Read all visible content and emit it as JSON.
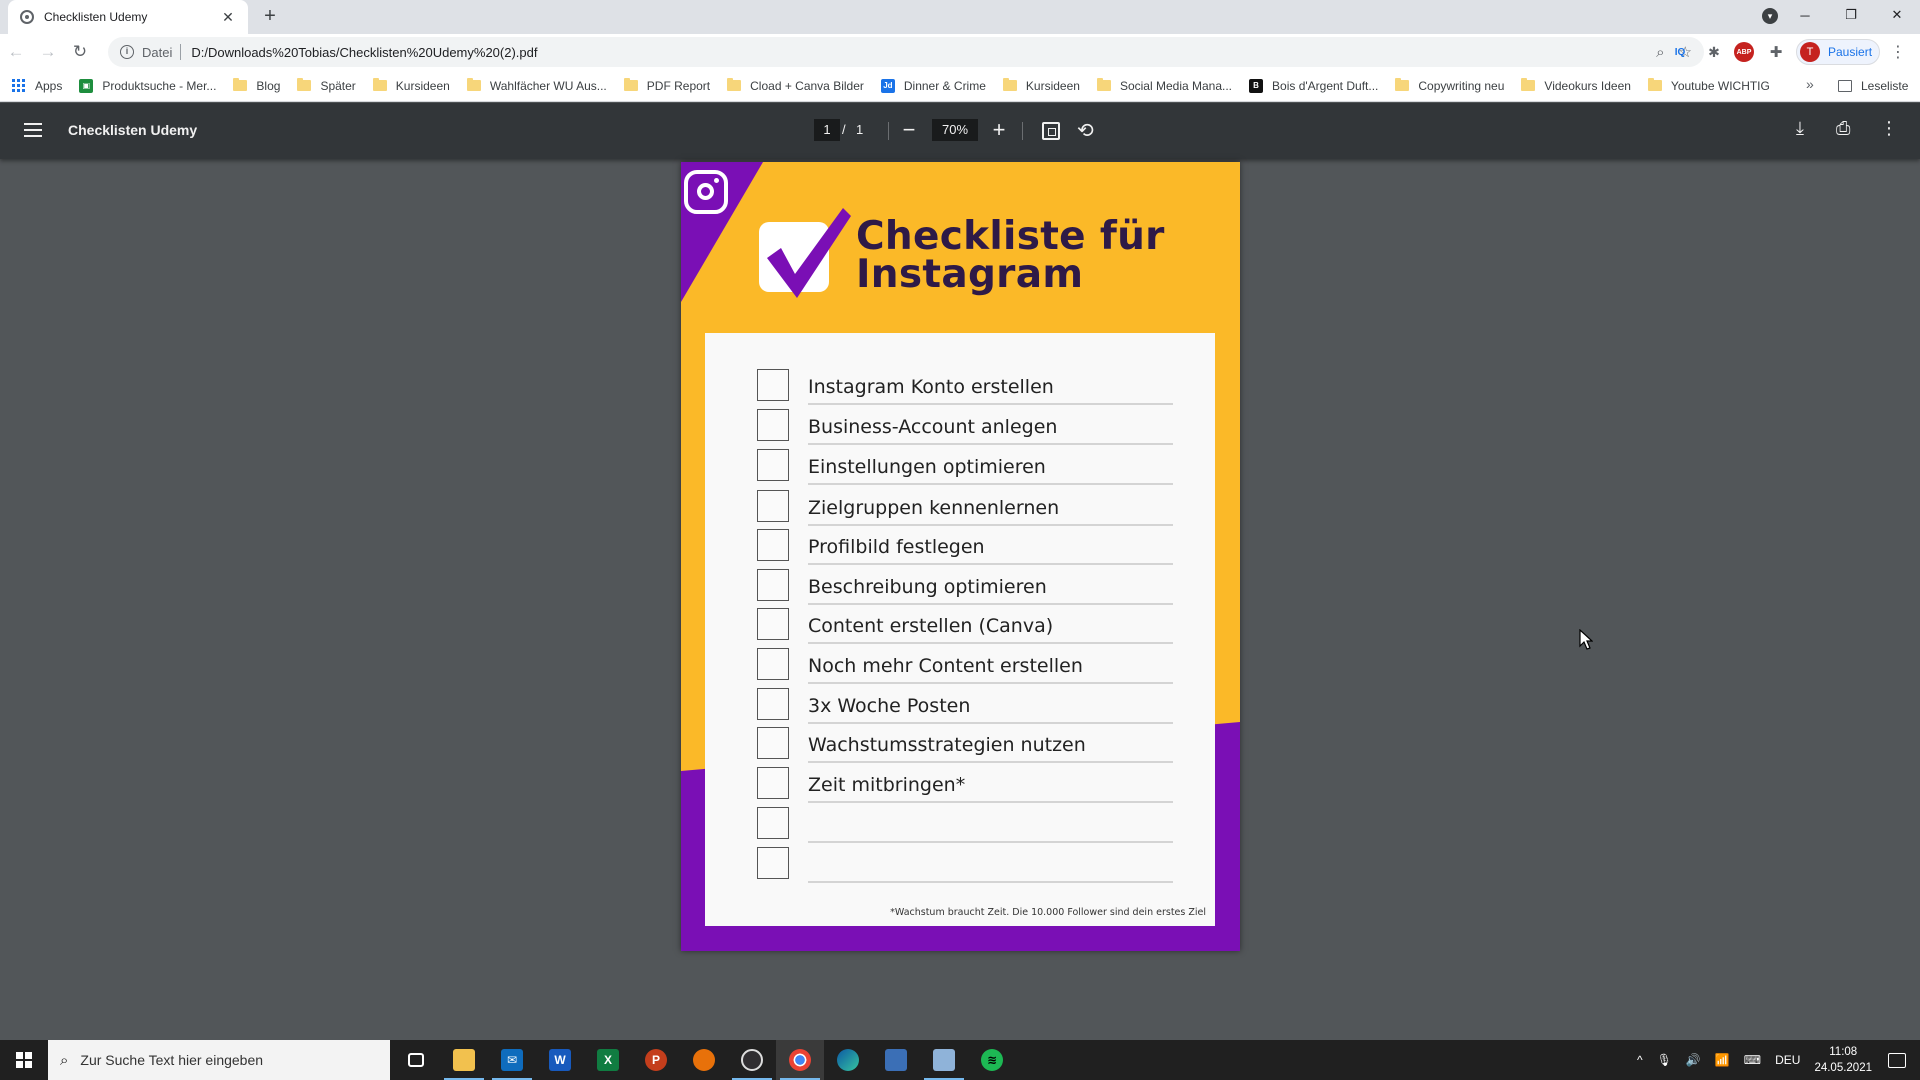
{
  "browser": {
    "tab_title": "Checklisten Udemy",
    "tab_close": "✕",
    "new_tab": "+",
    "scheme_label": "Datei",
    "url": "D:/Downloads%20Tobias/Checklisten%20Udemy%20(2).pdf",
    "profile_status": "Pausiert",
    "profile_initial": "T",
    "window_controls": [
      "─",
      "❐",
      "✕"
    ]
  },
  "bookmarks": {
    "apps": "Apps",
    "items": [
      {
        "label": "Produktsuche - Mer...",
        "icon": "site"
      },
      {
        "label": "Blog",
        "icon": "folder"
      },
      {
        "label": "Später",
        "icon": "folder"
      },
      {
        "label": "Kursideen",
        "icon": "folder"
      },
      {
        "label": "Wahlfächer WU Aus...",
        "icon": "folder"
      },
      {
        "label": "PDF Report",
        "icon": "folder"
      },
      {
        "label": "Cload + Canva Bilder",
        "icon": "folder"
      },
      {
        "label": "Dinner & Crime",
        "icon": "site-jd"
      },
      {
        "label": "Kursideen",
        "icon": "folder"
      },
      {
        "label": "Social Media Mana...",
        "icon": "folder"
      },
      {
        "label": "Bois d'Argent Duft...",
        "icon": "site-dark"
      },
      {
        "label": "Copywriting neu",
        "icon": "folder"
      },
      {
        "label": "Videokurs Ideen",
        "icon": "folder"
      },
      {
        "label": "Youtube WICHTIG",
        "icon": "folder"
      }
    ],
    "more": "»",
    "reading_list": "Leseliste"
  },
  "pdf_viewer": {
    "title": "Checklisten Udemy",
    "current_page": "1",
    "page_sep": "/",
    "total_pages": "1",
    "zoom": "70%"
  },
  "pdf_page": {
    "title_line1": "Checkliste für",
    "title_line2": "Instagram",
    "items": [
      "Instagram Konto erstellen",
      "Business-Account anlegen",
      "Einstellungen optimieren",
      "Zielgruppen kennenlernen",
      "Profilbild festlegen",
      "Beschreibung optimieren",
      "Content erstellen (Canva)",
      "Noch mehr Content erstellen",
      "3x Woche Posten",
      "Wachstumsstrategien nutzen",
      "Zeit mitbringen*",
      "",
      ""
    ],
    "footnote": "*Wachstum braucht Zeit. Die 10.000 Follower sind dein erstes Ziel",
    "colors": {
      "yellow": "#fbb928",
      "purple": "#7a0fb5",
      "title": "#2e1a47"
    }
  },
  "taskbar": {
    "search_placeholder": "Zur Suche Text hier eingeben",
    "language": "DEU",
    "time": "11:08",
    "date": "24.05.2021"
  }
}
